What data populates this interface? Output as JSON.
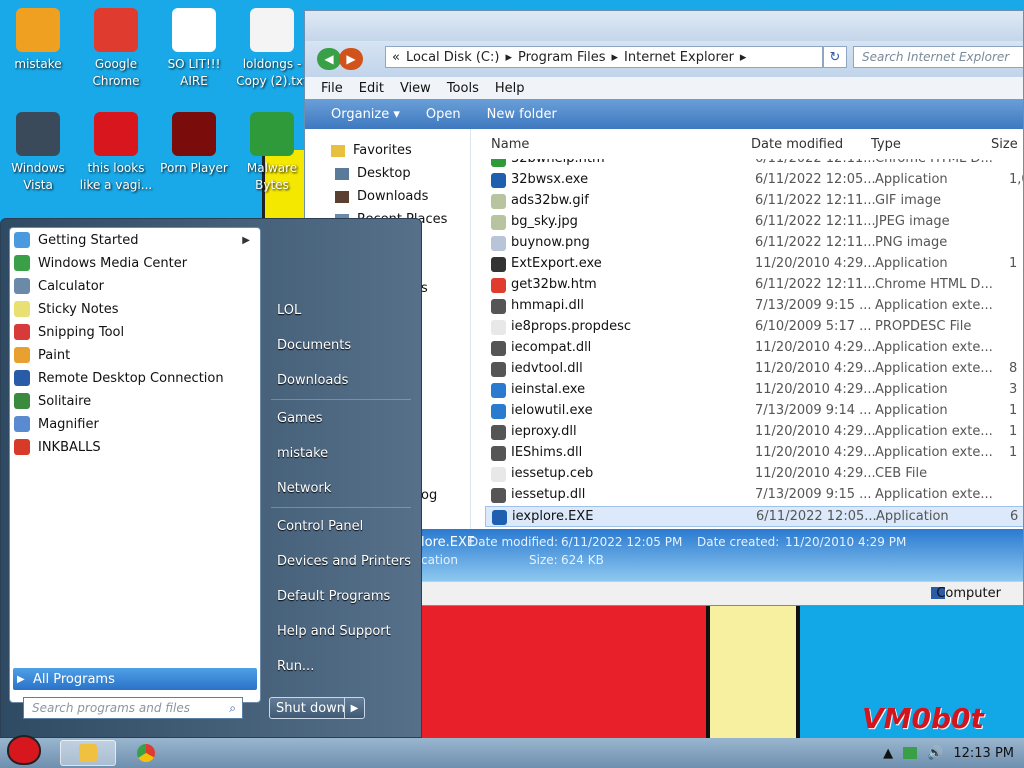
{
  "desktop": {
    "icons": [
      {
        "label": "mistake",
        "icon": "mistake-icon",
        "color": "#f0a020"
      },
      {
        "label": "Google Chrome",
        "icon": "chrome-icon",
        "color": "#e03b2f"
      },
      {
        "label": "SO LIT!!! AIRE",
        "icon": "solitaire-icon",
        "color": "#ffffff"
      },
      {
        "label": "loldongs - Copy (2).txt",
        "icon": "text-file-icon",
        "color": "#f4f4f4"
      },
      {
        "label": "Windows Vista",
        "icon": "recycle-bin-icon",
        "color": "#3a4a5a"
      },
      {
        "label": "this looks like a vagi...",
        "icon": "opera-icon",
        "color": "#d8161d"
      },
      {
        "label": "Porn Player",
        "icon": "flash-icon",
        "color": "#7a0c0c"
      },
      {
        "label": "Malware Bytes",
        "icon": "shield-icon",
        "color": "#2f9a3a"
      }
    ],
    "watermark": "VM0b0t"
  },
  "explorer": {
    "address": {
      "prefix": "«",
      "segments": [
        "Local Disk (C:)",
        "Program Files",
        "Internet Explorer"
      ],
      "separator": "▸"
    },
    "search_placeholder": "Search Internet Explorer",
    "menu": [
      "File",
      "Edit",
      "View",
      "Tools",
      "Help"
    ],
    "toolbar": {
      "organize": "Organize ▾",
      "open": "Open",
      "new_folder": "New folder"
    },
    "nav": {
      "favorites": "Favorites",
      "desktop": "Desktop",
      "downloads": "Downloads",
      "recent": "Recent Places"
    },
    "columns": {
      "name": "Name",
      "date": "Date modified",
      "type": "Type",
      "size": "Size"
    },
    "files": [
      {
        "name": "32bwhelp.htm",
        "date": "6/11/2022 12:11...",
        "type": "Chrome HTML D...",
        "size": "",
        "color": "#2f9a3a"
      },
      {
        "name": "32bwsx.exe",
        "date": "6/11/2022 12:05...",
        "type": "Application",
        "size": "1,0",
        "color": "#1e5fb0"
      },
      {
        "name": "ads32bw.gif",
        "date": "6/11/2022 12:11...",
        "type": "GIF image",
        "size": "",
        "color": "#b8c4a0"
      },
      {
        "name": "bg_sky.jpg",
        "date": "6/11/2022 12:11...",
        "type": "JPEG image",
        "size": "",
        "color": "#b8c4a0"
      },
      {
        "name": "buynow.png",
        "date": "6/11/2022 12:11...",
        "type": "PNG image",
        "size": "",
        "color": "#b8c4d8"
      },
      {
        "name": "ExtExport.exe",
        "date": "11/20/2010 4:29...",
        "type": "Application",
        "size": "1",
        "color": "#333333"
      },
      {
        "name": "get32bw.htm",
        "date": "6/11/2022 12:11...",
        "type": "Chrome HTML D...",
        "size": "",
        "color": "#e03b2f"
      },
      {
        "name": "hmmapi.dll",
        "date": "7/13/2009 9:15 ...",
        "type": "Application exte...",
        "size": "",
        "color": "#555555"
      },
      {
        "name": "ie8props.propdesc",
        "date": "6/10/2009 5:17 ...",
        "type": "PROPDESC File",
        "size": "",
        "color": "#e8e8e8"
      },
      {
        "name": "iecompat.dll",
        "date": "11/20/2010 4:29...",
        "type": "Application exte...",
        "size": "",
        "color": "#555555"
      },
      {
        "name": "iedvtool.dll",
        "date": "11/20/2010 4:29...",
        "type": "Application exte...",
        "size": "8",
        "color": "#555555"
      },
      {
        "name": "ieinstal.exe",
        "date": "11/20/2010 4:29...",
        "type": "Application",
        "size": "3",
        "color": "#2a7ad0"
      },
      {
        "name": "ielowutil.exe",
        "date": "7/13/2009 9:14 ...",
        "type": "Application",
        "size": "1",
        "color": "#2a7ad0"
      },
      {
        "name": "ieproxy.dll",
        "date": "11/20/2010 4:29...",
        "type": "Application exte...",
        "size": "1",
        "color": "#555555"
      },
      {
        "name": "IEShims.dll",
        "date": "11/20/2010 4:29...",
        "type": "Application exte...",
        "size": "1",
        "color": "#555555"
      },
      {
        "name": "iessetup.ceb",
        "date": "11/20/2010 4:29...",
        "type": "CEB File",
        "size": "",
        "color": "#e8e8e8"
      },
      {
        "name": "iessetup.dll",
        "date": "7/13/2009 9:15 ...",
        "type": "Application exte...",
        "size": "",
        "color": "#555555"
      },
      {
        "name": "iexplore.EXE",
        "date": "6/11/2022 12:05...",
        "type": "Application",
        "size": "6",
        "color": "#1e5fb0"
      }
    ],
    "details": {
      "filename": "lore.EXE",
      "date_modified_label": "Date modified:",
      "date_modified": "6/11/2022 12:05 PM",
      "date_created_label": "Date created:",
      "date_created": "11/20/2010 4:29 PM",
      "type_fragment": "cation",
      "size_label": "Size:",
      "size": "624 KB"
    },
    "status": "Computer",
    "partial_nav": {
      "a": "s",
      "b": "og"
    }
  },
  "startmenu": {
    "programs": [
      {
        "label": "Getting Started",
        "icon": "getting-started-icon",
        "color": "#4a9ae0",
        "submenu": true
      },
      {
        "label": "Windows Media Center",
        "icon": "media-center-icon",
        "color": "#3aa047"
      },
      {
        "label": "Calculator",
        "icon": "calculator-icon",
        "color": "#6a8aa8"
      },
      {
        "label": "Sticky Notes",
        "icon": "sticky-notes-icon",
        "color": "#e8e070"
      },
      {
        "label": "Snipping Tool",
        "icon": "snipping-tool-icon",
        "color": "#d83a3a"
      },
      {
        "label": "Paint",
        "icon": "paint-icon",
        "color": "#e8a030"
      },
      {
        "label": "Remote Desktop Connection",
        "icon": "remote-desktop-icon",
        "color": "#2a5ba8"
      },
      {
        "label": "Solitaire",
        "icon": "solitaire-icon",
        "color": "#3a8a40"
      },
      {
        "label": "Magnifier",
        "icon": "magnifier-icon",
        "color": "#5a8ad0"
      },
      {
        "label": "INKBALLS",
        "icon": "inkballs-icon",
        "color": "#d83a2a"
      }
    ],
    "submenu_arrow": "▶",
    "all_programs": "All Programs",
    "search_placeholder": "Search programs and files",
    "search_icon": "⌕",
    "right": [
      "LOL",
      "Documents",
      "Downloads",
      "Games",
      "mistake",
      "Network",
      "Control Panel",
      "Devices and Printers",
      "Default Programs",
      "Help and Support",
      "Run..."
    ],
    "shutdown": "Shut down",
    "shutdown_arrow": "▶"
  },
  "taskbar": {
    "clock": "12:13 PM",
    "tray_up": "▲",
    "tray_volume": "🔊"
  }
}
